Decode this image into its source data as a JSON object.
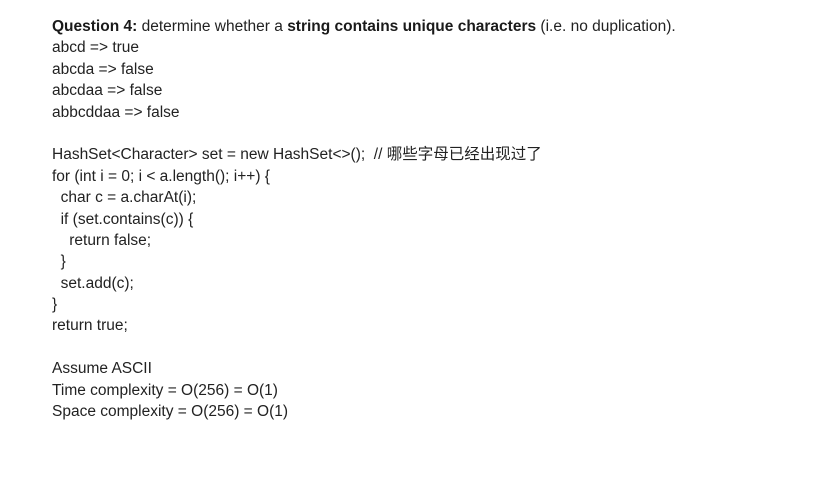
{
  "question": {
    "prefix": "Question 4:",
    "text_before": " determine whether a ",
    "emphasis": "string contains unique characters",
    "text_after": " (i.e. no duplication)."
  },
  "examples": [
    "abcd => true",
    "abcda => false",
    "abcdaa => false",
    "abbcddaa => false"
  ],
  "code": [
    "HashSet<Character> set = new HashSet<>();  // 哪些字母已经出现过了",
    "for (int i = 0; i < a.length(); i++) {",
    "  char c = a.charAt(i);",
    "  if (set.contains(c)) {",
    "    return false;",
    "  }",
    "  set.add(c);",
    "}",
    "return true;"
  ],
  "notes": [
    "Assume ASCII",
    "Time complexity = O(256) = O(1)",
    "Space complexity = O(256) = O(1)"
  ]
}
